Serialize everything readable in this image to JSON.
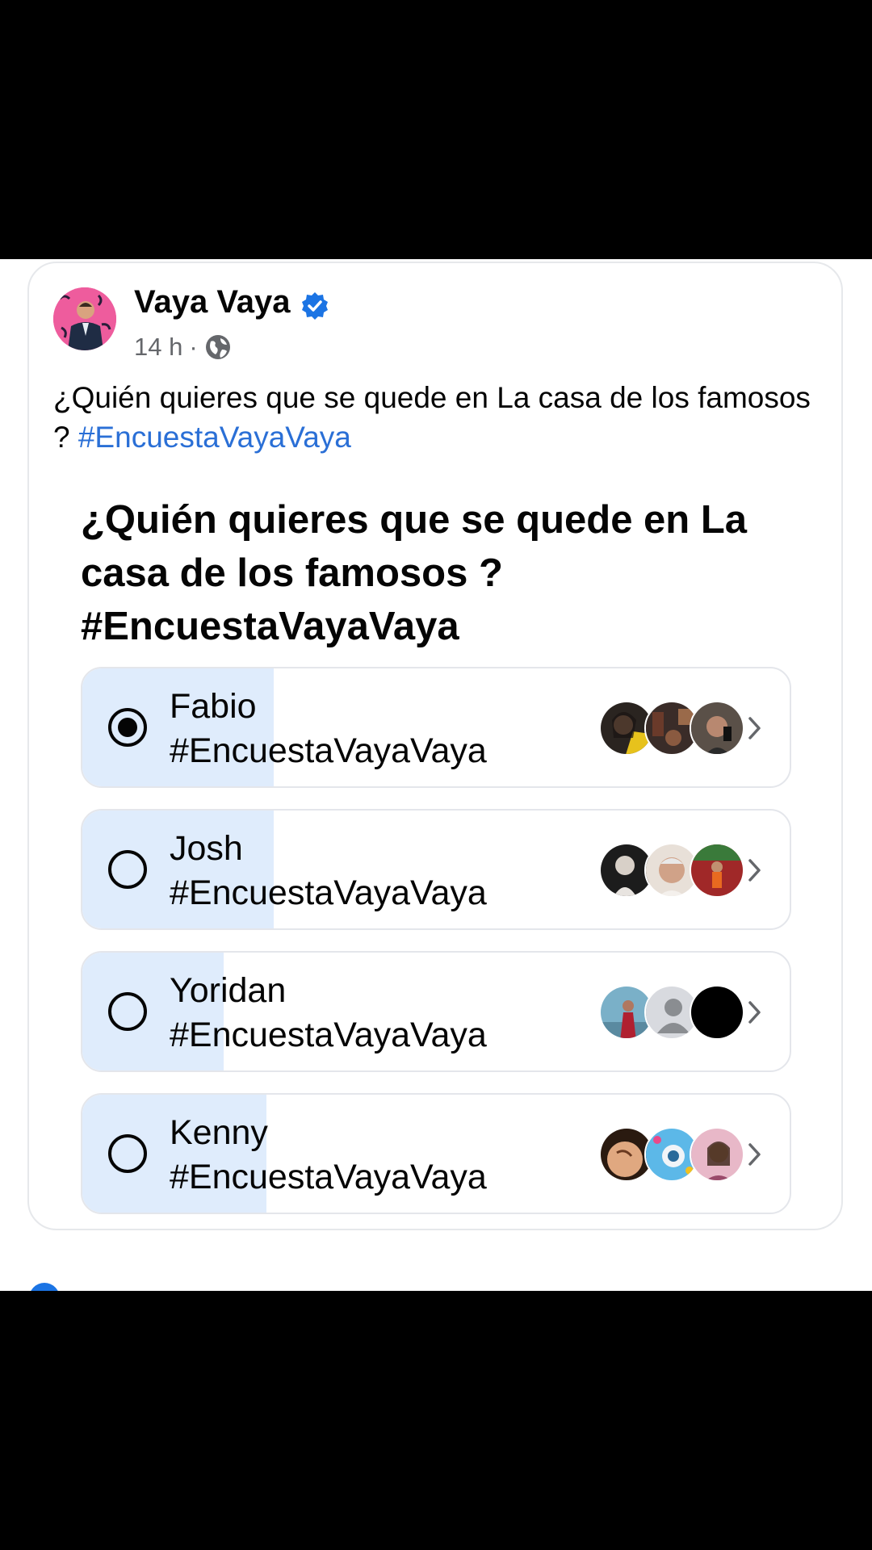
{
  "post": {
    "author": "Vaya Vaya",
    "time": "14 h",
    "separator": "·",
    "text_main": "¿Quién quieres que se quede en La casa de los famosos ? ",
    "hashtag": "#EncuestaVayaVaya"
  },
  "poll": {
    "title": "¿Quién quieres que se quede en La casa de los famosos ? #EncuestaVayaVaya",
    "options": [
      {
        "name": "Fabio",
        "tag": "#EncuestaVayaVaya",
        "selected": true,
        "share": 0.27
      },
      {
        "name": "Josh",
        "tag": "#EncuestaVayaVaya",
        "selected": false,
        "share": 0.27
      },
      {
        "name": "Yoridan",
        "tag": "#EncuestaVayaVaya",
        "selected": false,
        "share": 0.2
      },
      {
        "name": "Kenny",
        "tag": "#EncuestaVayaVaya",
        "selected": false,
        "share": 0.26
      }
    ]
  },
  "colors": {
    "accent": "#1b74e4",
    "hashtag": "#2a6fd6",
    "fill": "#dfecfc"
  },
  "icons": [
    "verified-badge-icon",
    "globe-icon",
    "radio-icon",
    "chevron-right-icon"
  ]
}
